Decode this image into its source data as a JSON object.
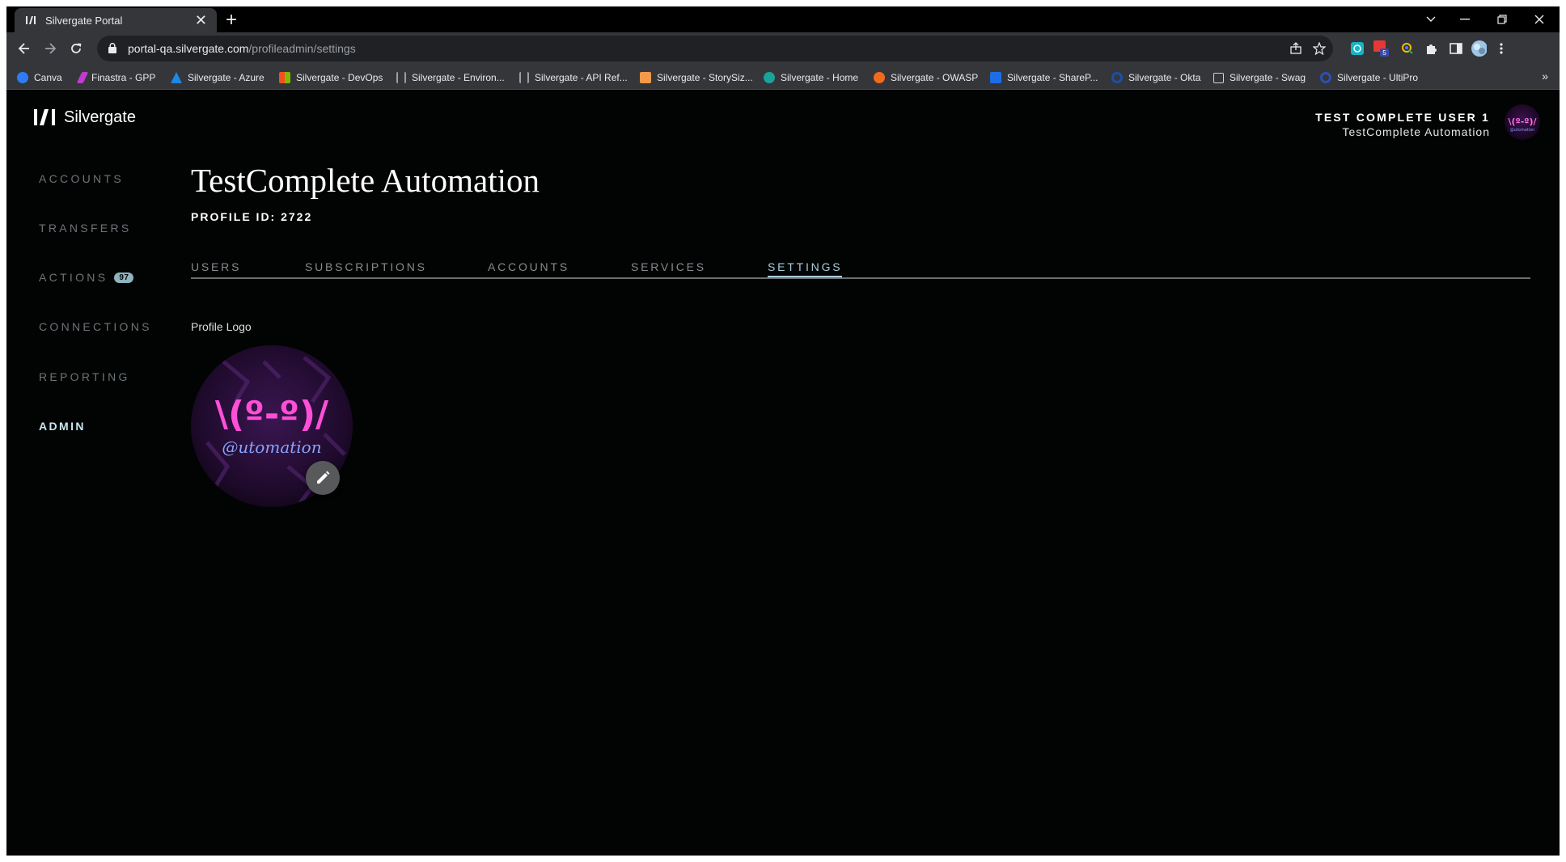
{
  "browser": {
    "tab_title": "Silvergate Portal",
    "url_host": "portal-qa.silvergate.com",
    "url_path": "/profileadmin/settings",
    "extension_badge": "5",
    "bookmarks": [
      {
        "label": "Canva",
        "color": "#2f7cf6"
      },
      {
        "label": "Finastra - GPP",
        "color": "#c13bd1"
      },
      {
        "label": "Silvergate - Azure",
        "color": "#1e88e5"
      },
      {
        "label": "Silvergate - DevOps",
        "color": "#f25022"
      },
      {
        "label": "Silvergate - Environ...",
        "color": "#9aa0a6"
      },
      {
        "label": "Silvergate - API Ref...",
        "color": "#9aa0a6"
      },
      {
        "label": "Silvergate - StorySiz...",
        "color": "#f2994a"
      },
      {
        "label": "Silvergate - Home",
        "color": "#1aa39a"
      },
      {
        "label": "Silvergate - OWASP",
        "color": "#f26b1d"
      },
      {
        "label": "Silvergate - ShareP...",
        "color": "#1d6ee6"
      },
      {
        "label": "Silvergate - Okta",
        "color": "#1b4fa8"
      },
      {
        "label": "Silvergate - Swag",
        "color": "#cfd2d6"
      },
      {
        "label": "Silvergate - UltiPro",
        "color": "#2b4fb8"
      }
    ],
    "more_glyph": "»"
  },
  "app": {
    "brand": "Silvergate",
    "nav": [
      {
        "label": "ACCOUNTS"
      },
      {
        "label": "TRANSFERS"
      },
      {
        "label": "ACTIONS",
        "badge": "97"
      },
      {
        "label": "CONNECTIONS"
      },
      {
        "label": "REPORTING"
      },
      {
        "label": "ADMIN",
        "active": true
      }
    ],
    "user": {
      "name": "TEST COMPLETE USER 1",
      "org": "TestComplete Automation"
    }
  },
  "main": {
    "title": "TestComplete Automation",
    "profile_id": "PROFILE ID: 2722",
    "tabs": [
      {
        "label": "USERS"
      },
      {
        "label": "SUBSCRIPTIONS"
      },
      {
        "label": "ACCOUNTS"
      },
      {
        "label": "SERVICES"
      },
      {
        "label": "SETTINGS",
        "active": true
      }
    ],
    "logo_label": "Profile Logo",
    "logo_text": "\\(º-º)/",
    "logo_subtext": "@utomation"
  },
  "colors": {
    "accent": "#a9cfde",
    "neon_pink": "#ff4fd8",
    "neon_blue": "#6f8dff",
    "page_bg": "#020403"
  }
}
